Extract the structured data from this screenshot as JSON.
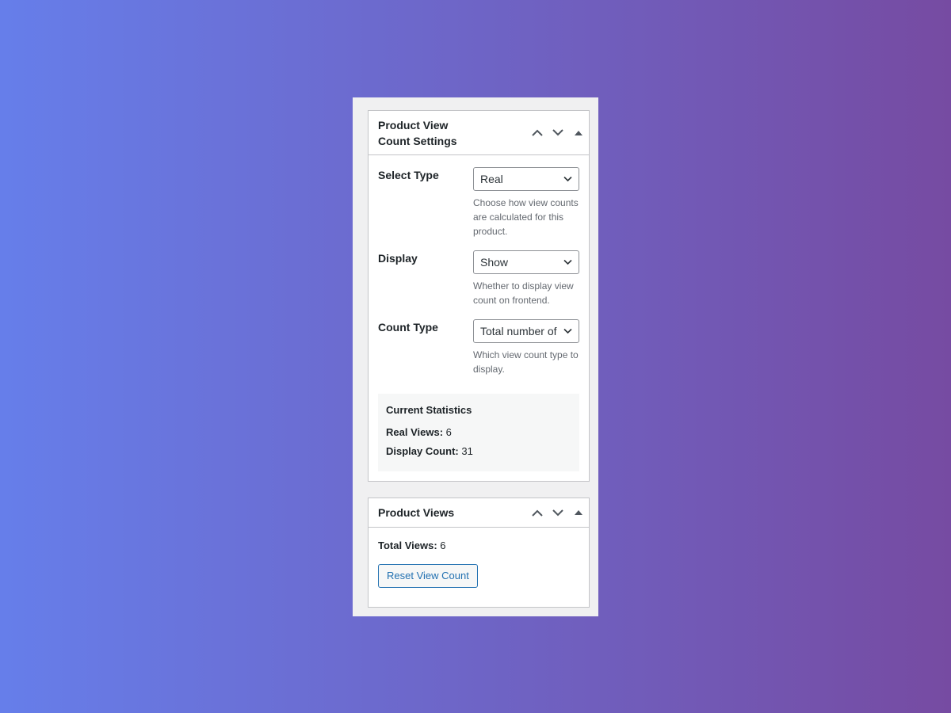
{
  "settings_box": {
    "title": "Product View Count Settings",
    "fields": [
      {
        "label": "Select Type",
        "value": "Real",
        "description": "Choose how view counts are calculated for this product."
      },
      {
        "label": "Display",
        "value": "Show",
        "description": "Whether to display view count on frontend."
      },
      {
        "label": "Count Type",
        "value": "Total number of",
        "description": "Which view count type to display."
      }
    ],
    "stats": {
      "title": "Current Statistics",
      "real_views_label": "Real Views:",
      "real_views_value": "6",
      "display_count_label": "Display Count:",
      "display_count_value": "31"
    }
  },
  "views_box": {
    "title": "Product Views",
    "total_label": "Total Views:",
    "total_value": "6",
    "reset_label": "Reset View Count"
  },
  "colors": {
    "accent": "#2271b1",
    "border": "#c3c4c7",
    "muted_text": "#646970"
  },
  "icons": {
    "move_up": "chevron-up-icon",
    "move_down": "chevron-down-icon",
    "toggle": "triangle-up-icon",
    "select_arrow": "chevron-down-icon"
  }
}
